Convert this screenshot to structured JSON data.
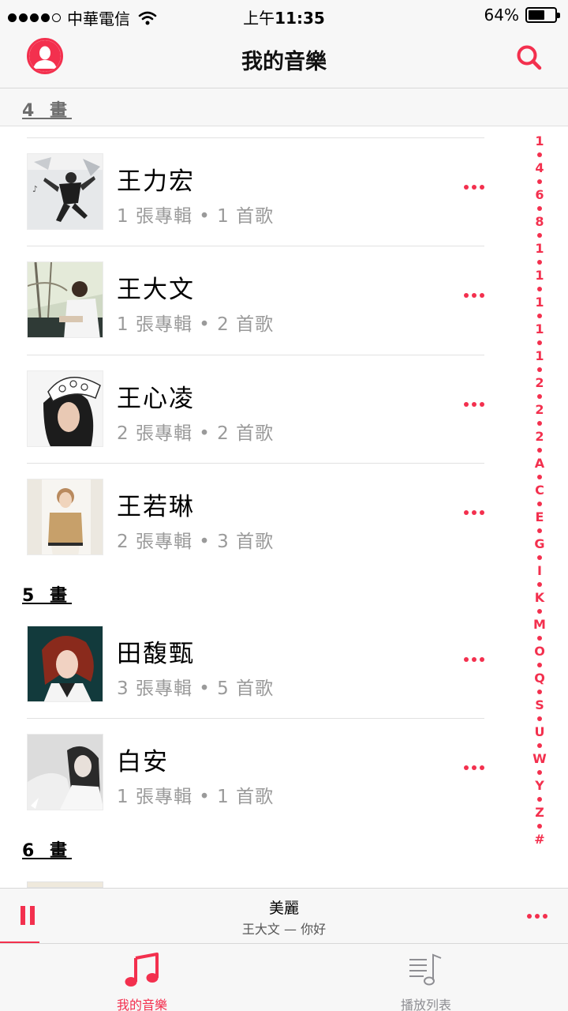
{
  "status_bar": {
    "carrier": "中華電信",
    "time_prefix": "上午",
    "time": "11:35",
    "battery": "64%",
    "battery_level": 0.64
  },
  "nav": {
    "title": "我的音樂",
    "avatar_icon": "profile-icon",
    "search_icon": "search-icon"
  },
  "sections": [
    {
      "label": "4 畫"
    },
    {
      "label": "5 畫"
    },
    {
      "label": "6 畫"
    }
  ],
  "artists": [
    {
      "name": "王力宏",
      "subtitle": "1 張專輯 • 1 首歌"
    },
    {
      "name": "王大文",
      "subtitle": "1 張專輯 • 2 首歌"
    },
    {
      "name": "王心凌",
      "subtitle": "2 張專輯 • 2 首歌"
    },
    {
      "name": "王若琳",
      "subtitle": "2 張專輯 • 3 首歌"
    },
    {
      "name": "田馥甄",
      "subtitle": "3 張專輯 • 5 首歌"
    },
    {
      "name": "白安",
      "subtitle": "1 張專輯 • 1 首歌"
    }
  ],
  "index_bar": [
    "1",
    "4",
    "6",
    "8",
    "1",
    "1",
    "1",
    "1",
    "1",
    "2",
    "2",
    "2",
    "A",
    "C",
    "E",
    "G",
    "I",
    "K",
    "M",
    "O",
    "Q",
    "S",
    "U",
    "W",
    "Y",
    "Z",
    "#"
  ],
  "now_playing": {
    "title": "美麗",
    "subtitle": "王大文 — 你好",
    "progress": 0.07
  },
  "tabs": [
    {
      "label": "我的音樂",
      "icon": "music-note-icon",
      "active": true
    },
    {
      "label": "播放列表",
      "icon": "playlist-icon",
      "active": false
    }
  ],
  "colors": {
    "accent": "#f3304e",
    "secondary_text": "#9a9a9a",
    "bar_background": "#f7f7f7"
  }
}
